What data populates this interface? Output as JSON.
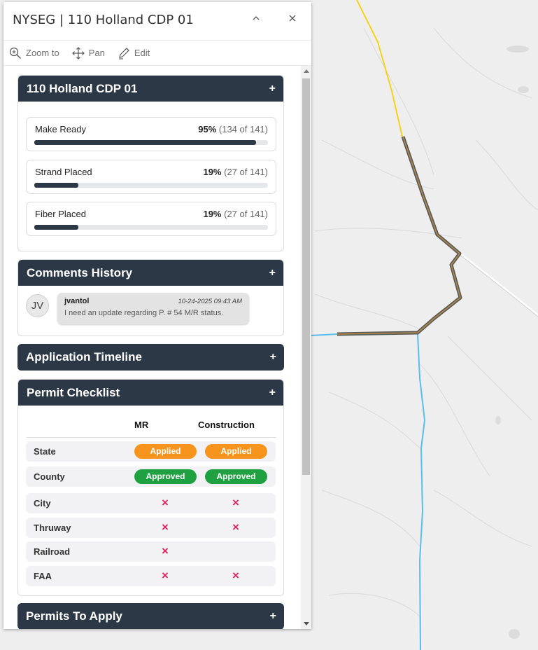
{
  "popup": {
    "title": "NYSEG | 110 Holland CDP 01",
    "collapse_icon": "chevron-up-icon",
    "close_icon": "close-icon"
  },
  "actions": [
    {
      "label": "Zoom to",
      "icon": "zoom-in-icon"
    },
    {
      "label": "Pan",
      "icon": "move-icon"
    },
    {
      "label": "Edit",
      "icon": "pencil-icon"
    }
  ],
  "summary": {
    "title": "110 Holland CDP 01",
    "expand_label": "+",
    "progress": [
      {
        "label": "Make Ready",
        "percent": "95%",
        "detail": "(134 of 141)",
        "fraction": 0.95
      },
      {
        "label": "Strand Placed",
        "percent": "19%",
        "detail": "(27 of 141)",
        "fraction": 0.19
      },
      {
        "label": "Fiber Placed",
        "percent": "19%",
        "detail": "(27 of 141)",
        "fraction": 0.19
      }
    ]
  },
  "comments": {
    "title": "Comments History",
    "expand_label": "+",
    "items": [
      {
        "initials": "JV",
        "user": "jvantol",
        "timestamp": "10-24-2025 09:43 AM",
        "text": "I need an update regarding P. # 54 M/R status."
      }
    ]
  },
  "timeline": {
    "title": "Application Timeline",
    "expand_label": "+"
  },
  "permits": {
    "title": "Permit Checklist",
    "expand_label": "+",
    "col_mr": "MR",
    "col_construction": "Construction",
    "rows": [
      {
        "label": "State",
        "mr": "Applied",
        "construction": "Applied"
      },
      {
        "label": "County",
        "mr": "Approved",
        "construction": "Approved"
      },
      {
        "label": "City",
        "mr": "×",
        "construction": "×"
      },
      {
        "label": "Thruway",
        "mr": "×",
        "construction": "×"
      },
      {
        "label": "Railroad",
        "mr": "×",
        "construction": ""
      },
      {
        "label": "FAA",
        "mr": "×",
        "construction": "×"
      }
    ],
    "colors": {
      "applied": "#f7941d",
      "approved": "#1fa142",
      "missing": "#e0245e"
    }
  },
  "permits_to_apply": {
    "title": "Permits To Apply",
    "expand_label": "+"
  },
  "map": {
    "colors": {
      "background": "#eeeeee",
      "route": "#7b6b50",
      "highway": "#f5d31a",
      "water": "#5bbcf0",
      "road": "#ffffff"
    }
  }
}
